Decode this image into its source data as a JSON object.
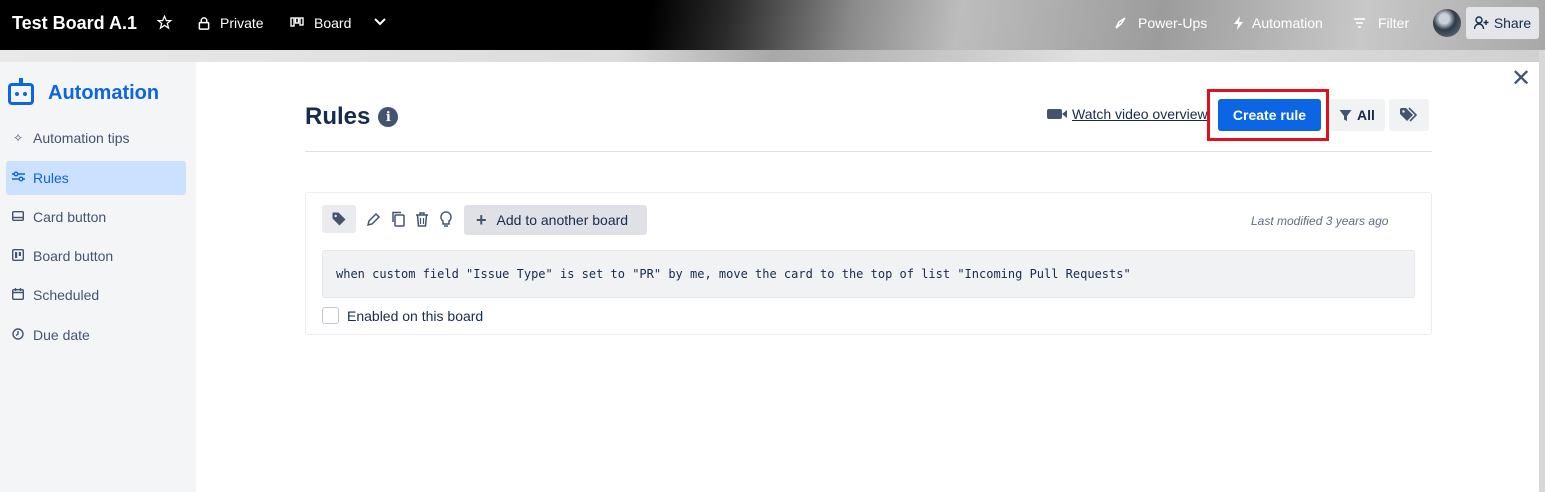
{
  "topbar": {
    "board_title": "Test Board A.1",
    "star_icon": "star-icon",
    "visibility": "Private",
    "view": "Board",
    "powerups": "Power-Ups",
    "automation": "Automation",
    "filter": "Filter",
    "share": "Share"
  },
  "sidebar": {
    "title": "Automation",
    "items": [
      {
        "label": "Automation tips",
        "icon": "sparkle-icon"
      },
      {
        "label": "Rules",
        "icon": "sliders-icon"
      },
      {
        "label": "Card button",
        "icon": "card-icon"
      },
      {
        "label": "Board button",
        "icon": "board-icon"
      },
      {
        "label": "Scheduled",
        "icon": "calendar-icon"
      },
      {
        "label": "Due date",
        "icon": "clock-icon"
      }
    ],
    "active_index": 1
  },
  "main": {
    "title": "Rules",
    "watch_video": "Watch video overview",
    "create_rule": "Create rule",
    "filter_all": "All"
  },
  "rule": {
    "add_to_board": "Add to another board",
    "last_modified": "Last modified 3 years ago",
    "description": "when custom field \"Issue Type\" is set to \"PR\" by me, move the card to the top of list \"Incoming Pull Requests\"",
    "enabled_label": "Enabled on this board",
    "enabled": false
  },
  "colors": {
    "accent": "#0c66e4",
    "highlight": "#e0101f"
  }
}
